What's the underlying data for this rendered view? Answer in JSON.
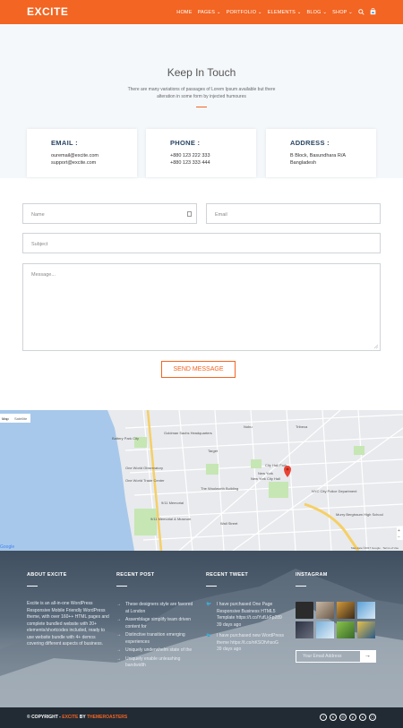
{
  "header": {
    "logo": "EXCITE",
    "nav": [
      "HOME",
      "PAGES",
      "PORTFOLIO",
      "ELEMENTS",
      "BLOG",
      "SHOP"
    ]
  },
  "hero": {
    "title": "Keep In Touch",
    "text": "There are many variations of passages of Lorem Ipsum available but there alteration in some form by injected humoures"
  },
  "cards": [
    {
      "title": "EMAIL :",
      "lines": [
        "ouremail@excite.com",
        "support@excite.com"
      ]
    },
    {
      "title": "PHONE :",
      "lines": [
        "+880 123 222 333",
        "+880 123 333 444"
      ]
    },
    {
      "title": "ADDRESS :",
      "lines": [
        "B Block, Basundhara R/A",
        "Bangladesh"
      ]
    }
  ],
  "form": {
    "name_placeholder": "Name",
    "email_placeholder": "Email",
    "subject_placeholder": "Subject",
    "message_placeholder": "Message...",
    "submit": "SEND MESSAGE"
  },
  "map": {
    "tab_map": "Map",
    "tab_satellite": "Satellite",
    "google": "Google",
    "labels": [
      "Battery Park City",
      "Goldman Sachs Headquarters",
      "Target",
      "One World Observatory",
      "One World Trade Center",
      "The Woolworth Building",
      "9/11 Memorial",
      "9/11 Memorial & Museum",
      "Wall Street",
      "City Hall Park",
      "New York City Hall",
      "NYC City Police Department",
      "Murry Bergtraum High School",
      "New York",
      "Tribeca",
      "Nobu"
    ],
    "credits": "Map data ©2017 Google · Terms of Use"
  },
  "footer": {
    "about_title": "ABOUT EXCITE",
    "about_text": "Excite is an all-in-one WordPress Responsive Mobile Friendly WordPress theme, with over 160++ HTML pages and complete bundled website with 20+ elements/shortcodes included, ready to use website bundle with 4+ demos covering different aspects of business.",
    "recent_title": "RECENT POST",
    "recent_posts": [
      "These designers style are favored at London",
      "Assemblage simplify team driven content for",
      "Distinctive transition emerging experiences",
      "Uniquely underwhelm state of the",
      "Uniquely enable unleashing bandwidth"
    ],
    "tweet_title": "RECENT TWEET",
    "tweets": [
      {
        "text": "I have purchased One Page Responsive Business HTML5 Template https://t.co/YufLkFp289",
        "time": "39 days ago"
      },
      {
        "text": "I have purchased new WordPress theme https://t.co/nKSOfvhsoG",
        "time": "39 days ago"
      }
    ],
    "insta_title": "INSTAGRAM",
    "newsletter_placeholder": "Your Email Address",
    "copyright_prefix": "© COPYRIGHT - ",
    "copyright_brand": "EXCITE",
    "copyright_by": " BY ",
    "copyright_author": "THEMEROASTERS"
  }
}
